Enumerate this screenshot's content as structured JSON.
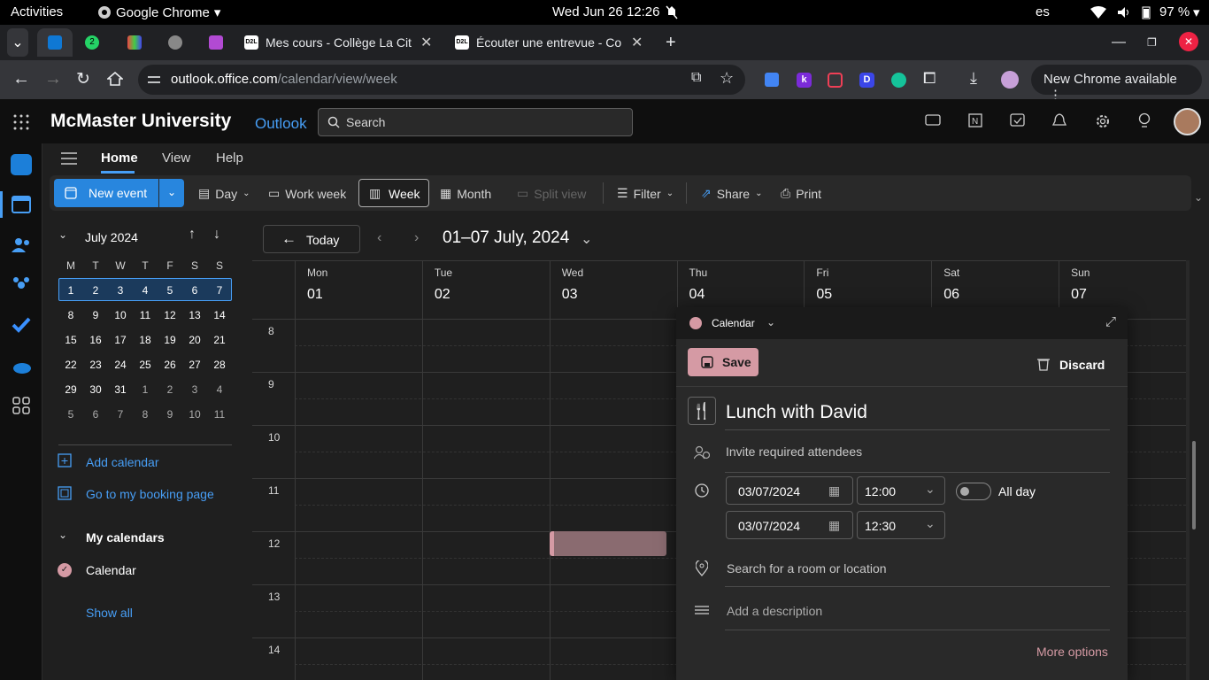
{
  "os": {
    "activities": "Activities",
    "app": "Google Chrome",
    "clock": "Wed Jun 26  12:26",
    "lang": "es",
    "battery": "97 %"
  },
  "tabs": [
    {
      "title": "Mes cours - Collège La Cité"
    },
    {
      "title": "Écouter une entrevue - Collège La Cité"
    }
  ],
  "badge_count": "2",
  "address": {
    "domain": "outlook.office.com",
    "path": "/calendar/view/week"
  },
  "new_chrome": "New Chrome available",
  "header": {
    "org": "McMaster University",
    "app": "Outlook",
    "search_placeholder": "Search"
  },
  "ribbon_tabs": [
    "Home",
    "View",
    "Help"
  ],
  "ribbon": {
    "new_event": "New event",
    "day": "Day",
    "work_week": "Work week",
    "week": "Week",
    "month": "Month",
    "split_view": "Split view",
    "filter": "Filter",
    "share": "Share",
    "print": "Print"
  },
  "mini_cal": {
    "month": "July 2024",
    "weekdays": [
      "M",
      "T",
      "W",
      "T",
      "F",
      "S",
      "S"
    ],
    "weeks": [
      [
        "1",
        "2",
        "3",
        "4",
        "5",
        "6",
        "7"
      ],
      [
        "8",
        "9",
        "10",
        "11",
        "12",
        "13",
        "14"
      ],
      [
        "15",
        "16",
        "17",
        "18",
        "19",
        "20",
        "21"
      ],
      [
        "22",
        "23",
        "24",
        "25",
        "26",
        "27",
        "28"
      ],
      [
        "29",
        "30",
        "31",
        "1",
        "2",
        "3",
        "4"
      ],
      [
        "5",
        "6",
        "7",
        "8",
        "9",
        "10",
        "11"
      ]
    ]
  },
  "left_links": {
    "add_calendar": "Add calendar",
    "booking": "Go to my booking page",
    "my_calendars": "My calendars",
    "calendar": "Calendar",
    "show_all": "Show all"
  },
  "cal_header": {
    "today": "Today",
    "range": "01–07 July, 2024"
  },
  "days": [
    {
      "name": "Mon",
      "num": "01"
    },
    {
      "name": "Tue",
      "num": "02"
    },
    {
      "name": "Wed",
      "num": "03"
    },
    {
      "name": "Thu",
      "num": "04"
    },
    {
      "name": "Fri",
      "num": "05"
    },
    {
      "name": "Sat",
      "num": "06"
    },
    {
      "name": "Sun",
      "num": "07"
    }
  ],
  "hours": [
    "8",
    "9",
    "10",
    "11",
    "12",
    "13",
    "14"
  ],
  "popup": {
    "calendar": "Calendar",
    "save": "Save",
    "discard": "Discard",
    "title": "Lunch with David",
    "attendees": "Invite required attendees",
    "start_date": "03/07/2024",
    "start_time": "12:00",
    "end_date": "03/07/2024",
    "end_time": "12:30",
    "all_day": "All day",
    "location": "Search for a room or location",
    "description": "Add a description",
    "more": "More options"
  },
  "colors": {
    "accent": "#479ef5",
    "event": "#d59aa4",
    "primary_button": "#2886de"
  }
}
